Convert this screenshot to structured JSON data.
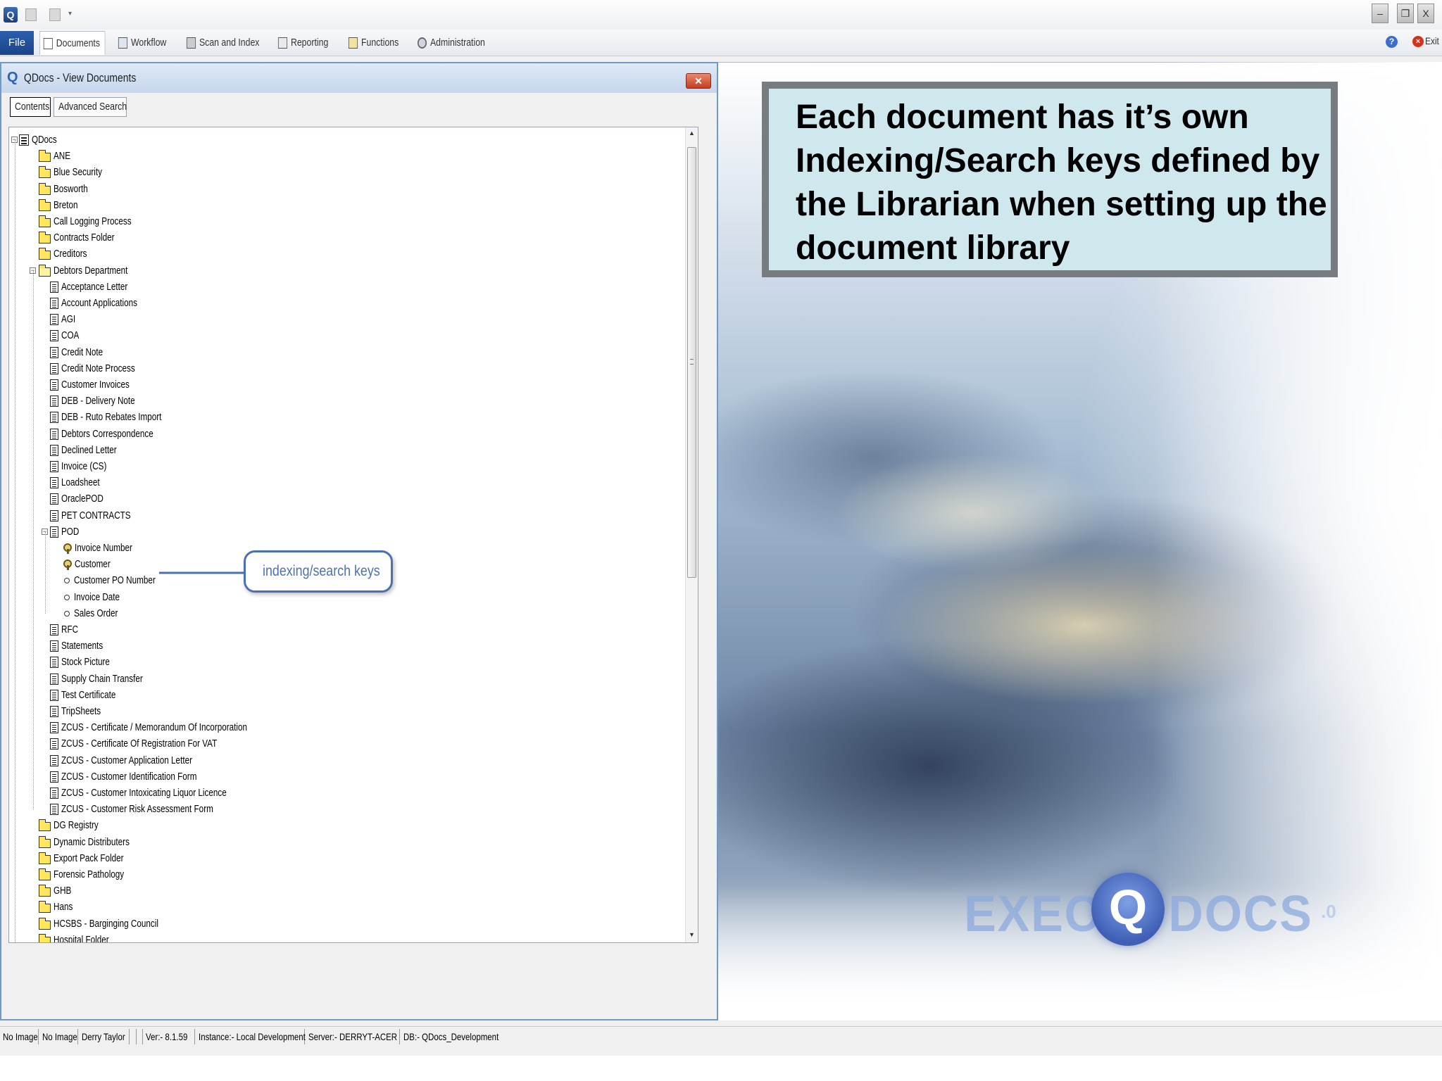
{
  "titlebar": {
    "app_icon": "Q",
    "window_buttons": [
      "minimize-icon",
      "restore-icon",
      "close-icon"
    ],
    "close_glyph": "X"
  },
  "menu": {
    "file": "File",
    "tabs": [
      "Documents",
      "Workflow",
      "Scan and Index",
      "Reporting",
      "Functions",
      "Administration"
    ],
    "exit": "Exit"
  },
  "doc_window": {
    "title": "QDocs - View Documents",
    "tabs": [
      "Contents",
      "Advanced Search"
    ]
  },
  "tree": {
    "root": "QDocs",
    "folders_top": [
      "ANE",
      "Blue Security",
      "Bosworth",
      "Breton",
      "Call Logging Process",
      "Contracts Folder",
      "Creditors"
    ],
    "debtors": "Debtors Department",
    "debtor_docs_a": [
      "Acceptance Letter",
      "Account Applications",
      "AGI",
      "COA",
      "Credit Note",
      "Credit Note Process",
      "Customer Invoices",
      "DEB - Delivery Note",
      "DEB - Ruto Rebates Import",
      "Debtors Correspondence",
      "Declined Letter",
      "Invoice (CS)",
      "Loadsheet",
      "OraclePOD",
      "PET CONTRACTS"
    ],
    "pod": "POD",
    "pod_keys": [
      "Invoice Number",
      "Customer",
      "Customer PO Number",
      "Invoice Date",
      "Sales Order"
    ],
    "debtor_docs_b": [
      "RFC",
      "Statements",
      "Stock Picture",
      "Supply Chain Transfer",
      "Test Certificate",
      "TripSheets",
      "ZCUS - Certificate / Memorandum Of Incorporation",
      "ZCUS - Certificate Of Registration For VAT",
      "ZCUS - Customer Application Letter",
      "ZCUS - Customer Identification Form",
      "ZCUS - Customer Intoxicating Liquor Licence",
      "ZCUS - Customer Risk Assessment Form"
    ],
    "folders_bottom": [
      "DG Registry",
      "Dynamic Distributers",
      "Export Pack Folder",
      "Forensic Pathology",
      "GHB",
      "Hans",
      "HCSBS - Barginging Council",
      "Hospital Folder"
    ]
  },
  "callout": "indexing/search keys",
  "note": "Each document has it’s own Indexing/Search keys defined by the Librarian when setting up the document library",
  "brand": {
    "left": "EXEC",
    "q": "Q",
    "right": "DOCS",
    "version": ".0"
  },
  "status": [
    "No Image",
    "No Image",
    "Derry Taylor",
    "",
    "",
    "Ver:- 8.1.59",
    "Instance:- Local Development",
    "Server:- DERRYT-ACER",
    "DB:- QDocs_Development"
  ],
  "colors": {
    "accent": "#2b5fae",
    "window_border": "#6f99c6",
    "note_bg": "#cfe8ee",
    "callout": "#4a72b0"
  }
}
